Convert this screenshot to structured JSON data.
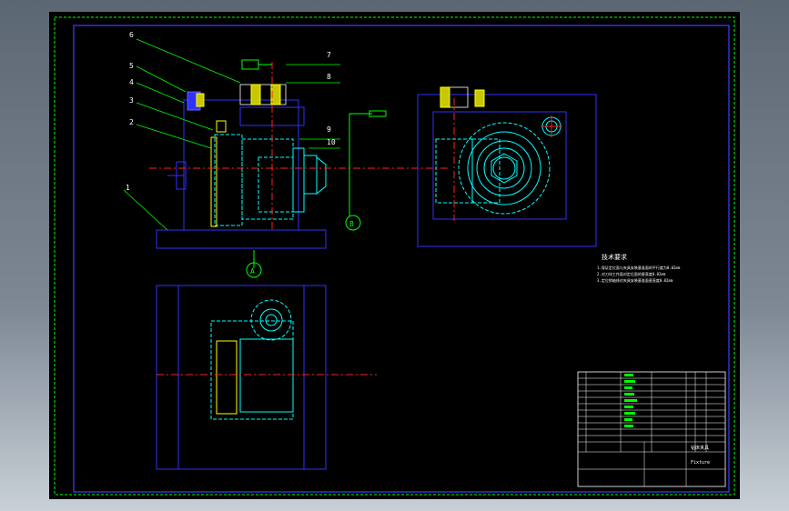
{
  "drawing": {
    "part_callouts": [
      "6",
      "5",
      "4",
      "3",
      "2",
      "1",
      "7",
      "8",
      "9",
      "10"
    ],
    "section_marks": [
      "A",
      "B"
    ],
    "notes_title": "技术要求",
    "notes_lines": [
      "1.保证定位面与夹具安装基准面的平行度为0.02mm",
      "2.对刀块工作面对定位面的垂直度0.02mm",
      "3.定位销轴线对夹具安装基准面垂直度0.02mm"
    ],
    "title_block": {
      "drawing_name": "钻床夹具",
      "drawing_no": "Fixture"
    },
    "colors": {
      "background": "#000000",
      "frame": "#0000ff",
      "outer_frame": "#00ff00",
      "part_cyan": "#00ffff",
      "centerline": "#ff0000",
      "leader": "#00ff00",
      "pin_yellow": "#ffff00",
      "callout_text": "#ffffff"
    }
  }
}
